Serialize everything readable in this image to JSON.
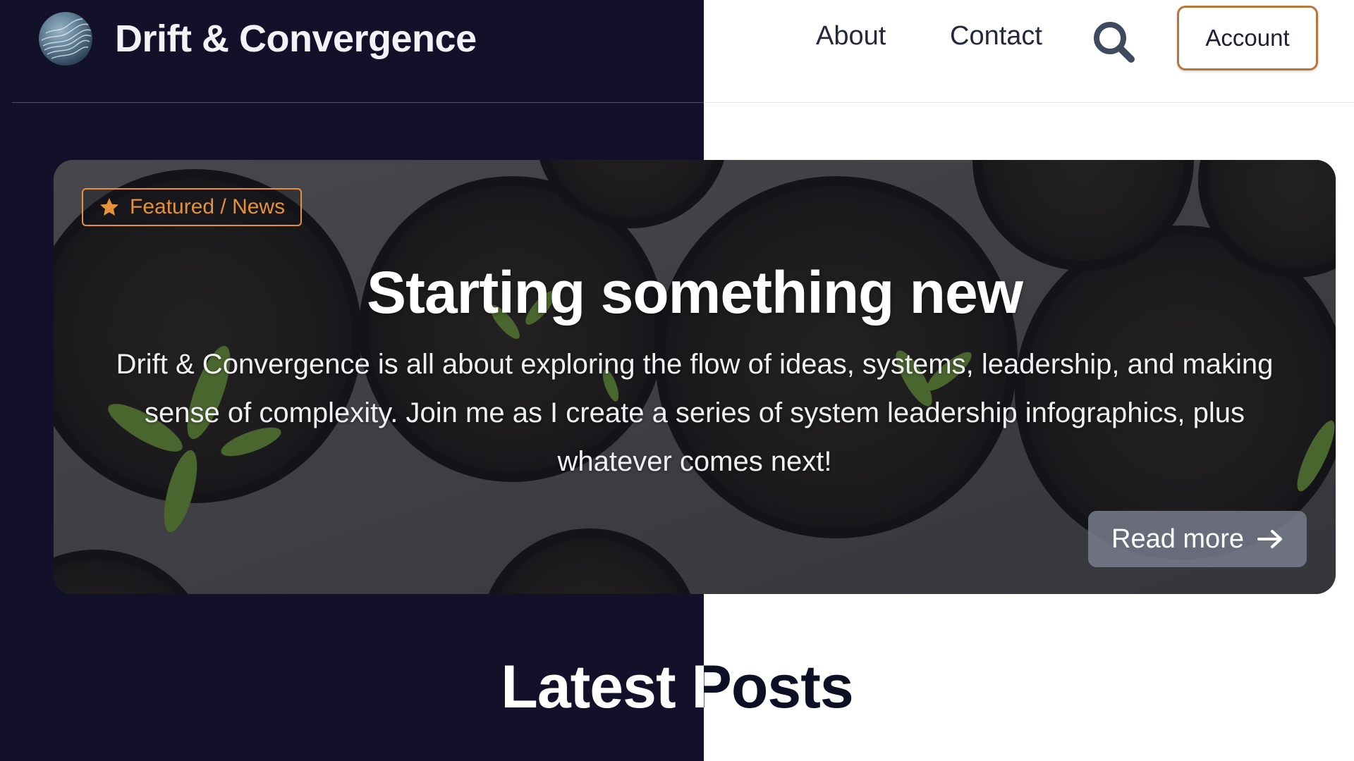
{
  "header": {
    "site_title": "Drift & Convergence",
    "logo_icon": "globe-logo-icon",
    "nav": {
      "about_label": "About",
      "contact_label": "Contact",
      "search_icon": "search-icon",
      "account_label": "Account"
    }
  },
  "hero": {
    "badge": {
      "icon": "star-icon",
      "label": "Featured / News"
    },
    "title": "Starting something new",
    "description": "Drift & Convergence is all about exploring the flow of ideas, systems, leadership, and making sense of complexity. Join me as I create a series of system leadership infographics, plus whatever comes next!",
    "read_more_label": "Read more",
    "read_more_icon": "arrow-right-icon"
  },
  "section": {
    "latest_posts_title": "Latest Posts"
  },
  "colors": {
    "dark_panel": "#13112a",
    "accent_orange": "#e7913b",
    "account_border": "#b9763a"
  }
}
